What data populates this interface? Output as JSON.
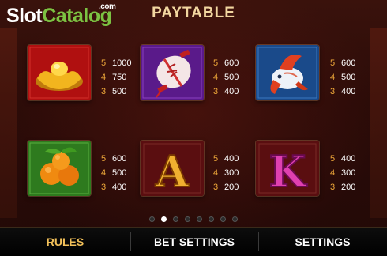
{
  "watermark": {
    "slot": "Slot",
    "catalog": "Catalog",
    "com": ".com"
  },
  "title": "PAYTABLE",
  "symbols": [
    {
      "name": "gold-ingot",
      "pays": [
        {
          "n": "5",
          "v": "1000"
        },
        {
          "n": "4",
          "v": "750"
        },
        {
          "n": "3",
          "v": "500"
        }
      ]
    },
    {
      "name": "lantern",
      "pays": [
        {
          "n": "5",
          "v": "600"
        },
        {
          "n": "4",
          "v": "500"
        },
        {
          "n": "3",
          "v": "400"
        }
      ]
    },
    {
      "name": "koi-fish",
      "pays": [
        {
          "n": "5",
          "v": "600"
        },
        {
          "n": "4",
          "v": "500"
        },
        {
          "n": "3",
          "v": "400"
        }
      ]
    },
    {
      "name": "oranges",
      "pays": [
        {
          "n": "5",
          "v": "600"
        },
        {
          "n": "4",
          "v": "500"
        },
        {
          "n": "3",
          "v": "400"
        }
      ]
    },
    {
      "name": "letter-a",
      "letter": "A",
      "pays": [
        {
          "n": "5",
          "v": "400"
        },
        {
          "n": "4",
          "v": "300"
        },
        {
          "n": "3",
          "v": "200"
        }
      ]
    },
    {
      "name": "letter-k",
      "letter": "K",
      "pays": [
        {
          "n": "5",
          "v": "400"
        },
        {
          "n": "4",
          "v": "300"
        },
        {
          "n": "3",
          "v": "200"
        }
      ]
    }
  ],
  "pagination": {
    "total": 8,
    "active": 1
  },
  "tabs": [
    {
      "label": "RULES",
      "active": true
    },
    {
      "label": "BET SETTINGS",
      "active": false
    },
    {
      "label": "SETTINGS",
      "active": false
    }
  ],
  "colors": {
    "tab_active": "#f3c15a",
    "multiplier": "#f0a93a",
    "value": "#ffffff",
    "title": "#f2d6a0"
  }
}
